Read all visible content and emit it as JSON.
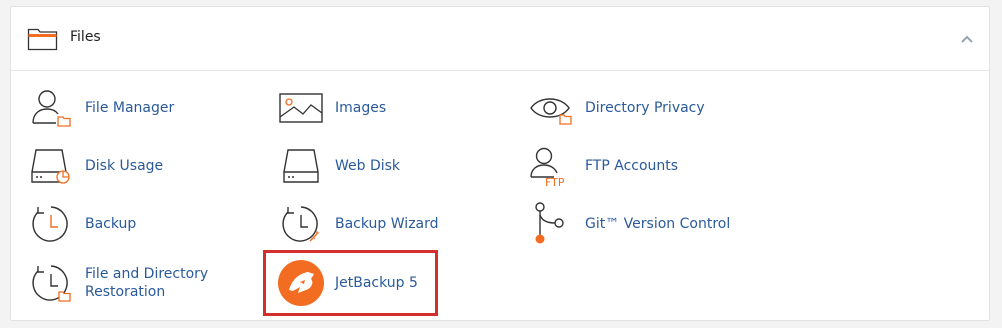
{
  "section": {
    "title": "Files",
    "header_icon": "folder-icon",
    "collapse_icon": "chevron-up-icon"
  },
  "items": [
    {
      "label": "File Manager",
      "icon": "file-manager-icon"
    },
    {
      "label": "Images",
      "icon": "image-icon"
    },
    {
      "label": "Directory Privacy",
      "icon": "eye-icon"
    },
    {
      "label": "Disk Usage",
      "icon": "disk-usage-icon"
    },
    {
      "label": "Web Disk",
      "icon": "web-disk-icon"
    },
    {
      "label": "FTP Accounts",
      "icon": "ftp-user-icon"
    },
    {
      "label": "Backup",
      "icon": "backup-clock-icon"
    },
    {
      "label": "Backup Wizard",
      "icon": "backup-wizard-icon"
    },
    {
      "label": "Git™ Version Control",
      "icon": "git-icon"
    },
    {
      "label": "File and Directory Restoration",
      "icon": "restore-icon"
    },
    {
      "label": "JetBackup 5",
      "icon": "jetbackup-icon"
    }
  ],
  "colors": {
    "accent": "#f26d21",
    "link": "#2a5a9b",
    "highlight": "#d32f2f"
  }
}
